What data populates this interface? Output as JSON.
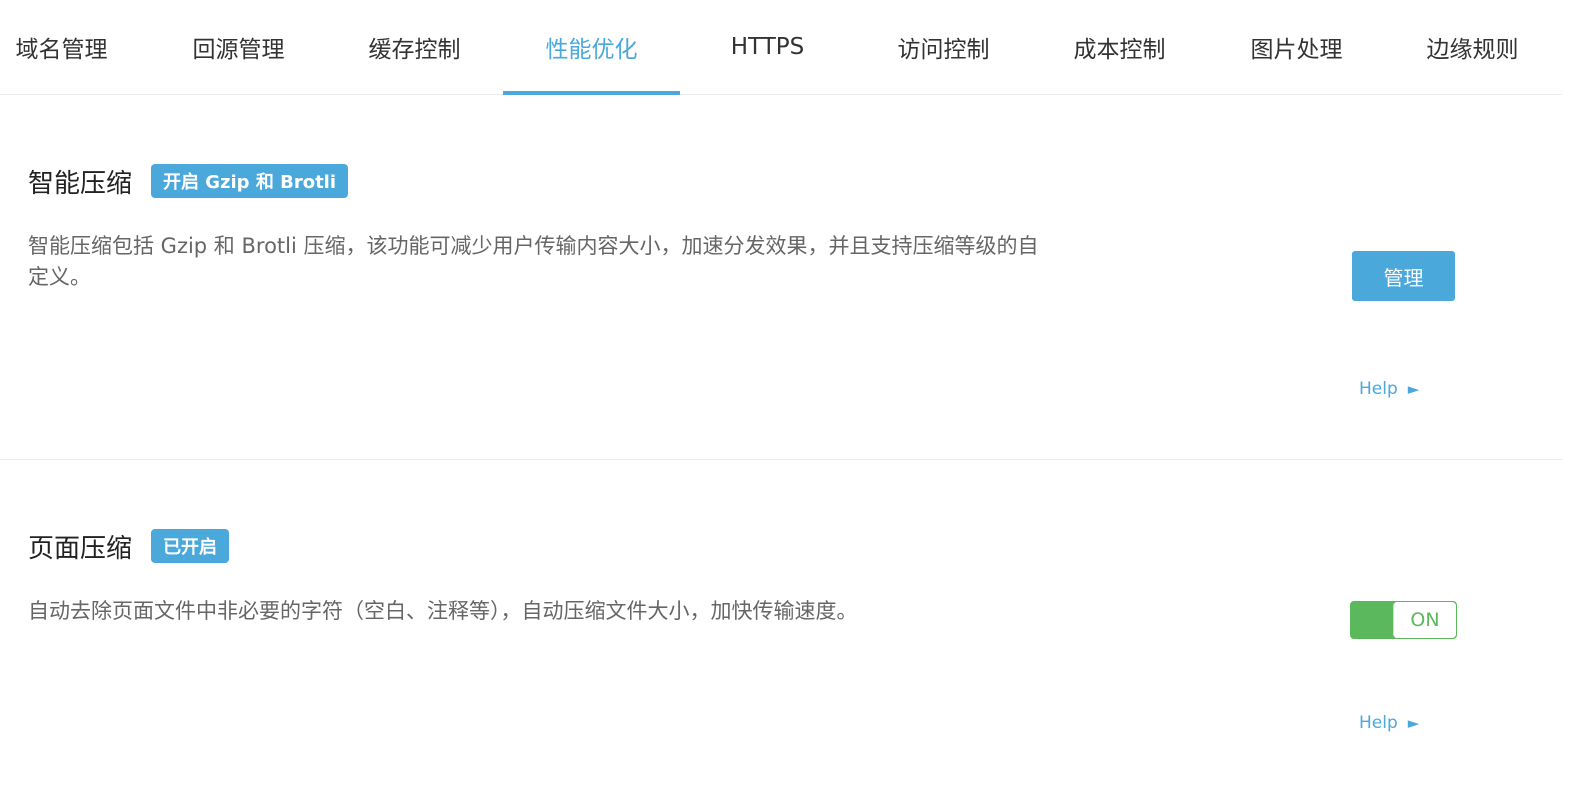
{
  "tabs": [
    {
      "label": "域名管理",
      "active": false
    },
    {
      "label": "回源管理",
      "active": false
    },
    {
      "label": "缓存控制",
      "active": false
    },
    {
      "label": "性能优化",
      "active": true
    },
    {
      "label": "HTTPS",
      "active": false
    },
    {
      "label": "访问控制",
      "active": false
    },
    {
      "label": "成本控制",
      "active": false
    },
    {
      "label": "图片处理",
      "active": false
    },
    {
      "label": "边缘规则",
      "active": false
    }
  ],
  "smart_compression": {
    "title": "智能压缩",
    "badge": "开启 Gzip 和 Brotli",
    "description": "智能压缩包括 Gzip 和 Brotli 压缩，该功能可减少用户传输内容大小，加速分发效果，并且支持压缩等级的自定义。",
    "manage_label": "管理",
    "help_label": "Help",
    "help_icon": "triangle-right-icon"
  },
  "page_compression": {
    "title": "页面压缩",
    "badge": "已开启",
    "description": "自动去除页面文件中非必要的字符（空白、注释等），自动压缩文件大小，加快传输速度。",
    "toggle_label": "ON",
    "toggle_on": true,
    "help_label": "Help",
    "help_icon": "triangle-right-icon"
  },
  "colors": {
    "accent": "#4aa8db",
    "toggle_on": "#5cb85c",
    "divider": "#e9ecef"
  }
}
